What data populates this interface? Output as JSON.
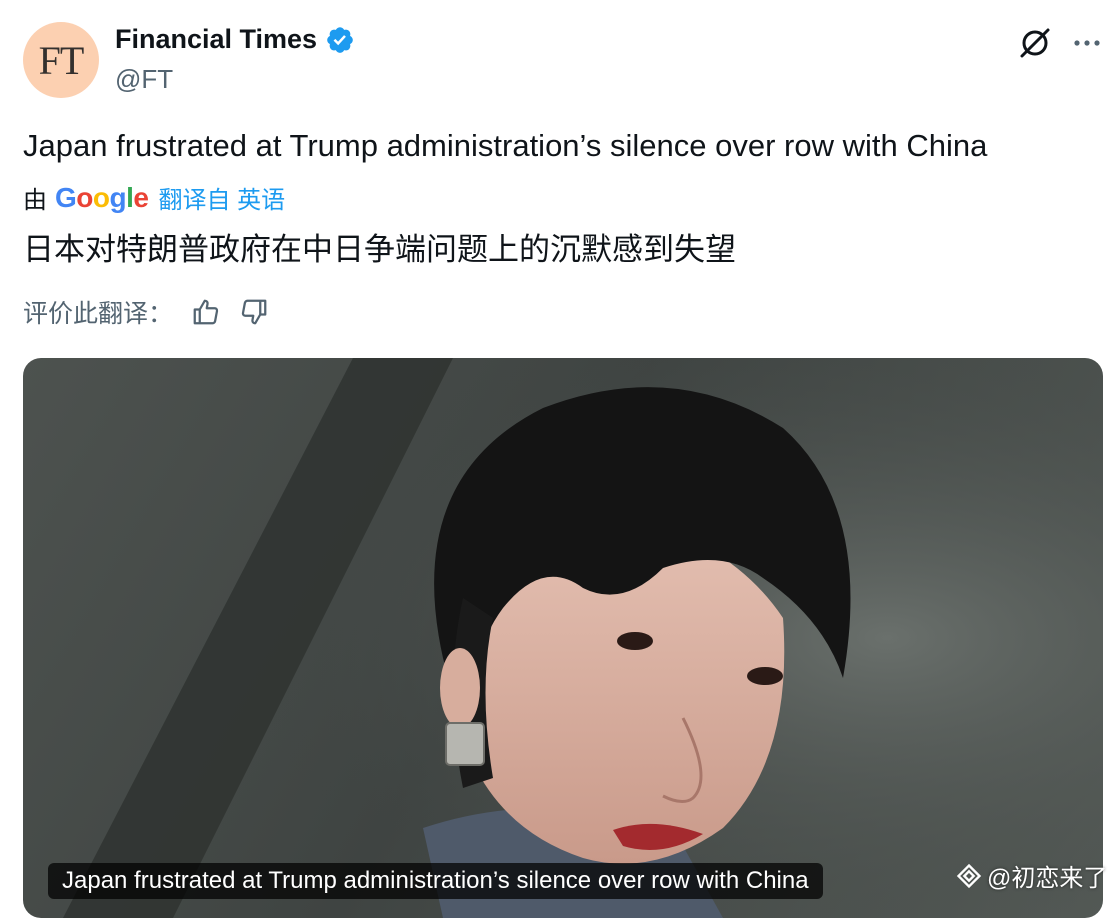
{
  "post": {
    "author": {
      "avatar_text": "FT",
      "name": "Financial Times",
      "handle": "@FT"
    },
    "headline": "Japan frustrated at Trump administration’s silence over row with China",
    "translation": {
      "by_label": "由",
      "provider": "Google",
      "link_label": "翻译自 英语",
      "translated_text": "日本对特朗普政府在中日争端问题上的沉默感到失望",
      "rate_label": "评价此翻译："
    },
    "media": {
      "caption": "Japan frustrated at Trump administration’s silence over row with China"
    }
  },
  "watermark": {
    "text": "@初恋来了"
  },
  "icons": {
    "verified": "verified-badge-icon",
    "grok": "grok-icon",
    "more": "more-options-icon",
    "thumb_up": "thumbs-up-icon",
    "thumb_down": "thumbs-down-icon"
  },
  "colors": {
    "link": "#1d9bf0",
    "avatar_bg": "#fcd0b1",
    "secondary_text": "#536471",
    "google_blue": "#4285f4",
    "google_red": "#ea4335",
    "google_yellow": "#fbbc05",
    "google_green": "#34a853"
  }
}
